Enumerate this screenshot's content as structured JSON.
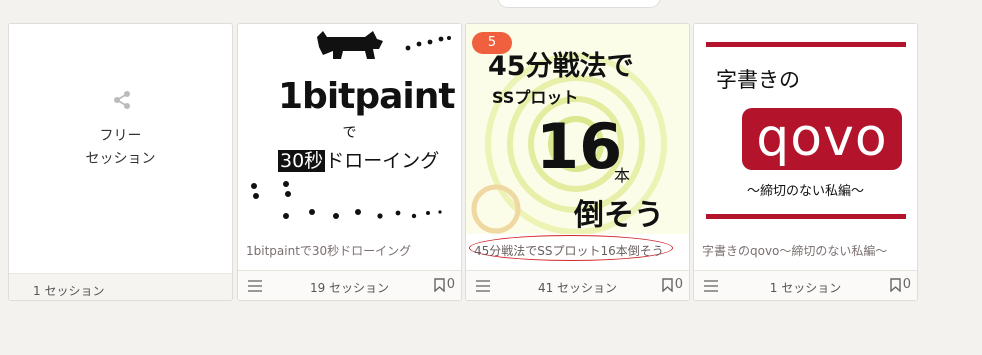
{
  "cards": [
    {
      "thumb_label_line1": "フリー",
      "thumb_label_line2": "セッション",
      "count": "1 セッション"
    },
    {
      "art_title": "1bitpaint",
      "art_de": "で",
      "art_highlight": "30秒",
      "art_rest": "ドローイング",
      "title": "1bitpaintで30秒ドローイング",
      "count": "19 セッション",
      "bookmarks": "0"
    },
    {
      "badge": "5",
      "art_line1": "45分戦法で",
      "art_line2": "SSプロット",
      "art_num": "16",
      "art_hon": "本",
      "art_line3": "倒そう",
      "title": "45分戦法でSSプロット16本倒そう",
      "count": "41 セッション",
      "bookmarks": "0"
    },
    {
      "art_line1": "字書きの",
      "art_logo": "qovo",
      "art_sub": "～締切のない私編～",
      "title": "字書きのqovo～締切のない私編～",
      "count": "1 セッション",
      "bookmarks": "0"
    }
  ]
}
